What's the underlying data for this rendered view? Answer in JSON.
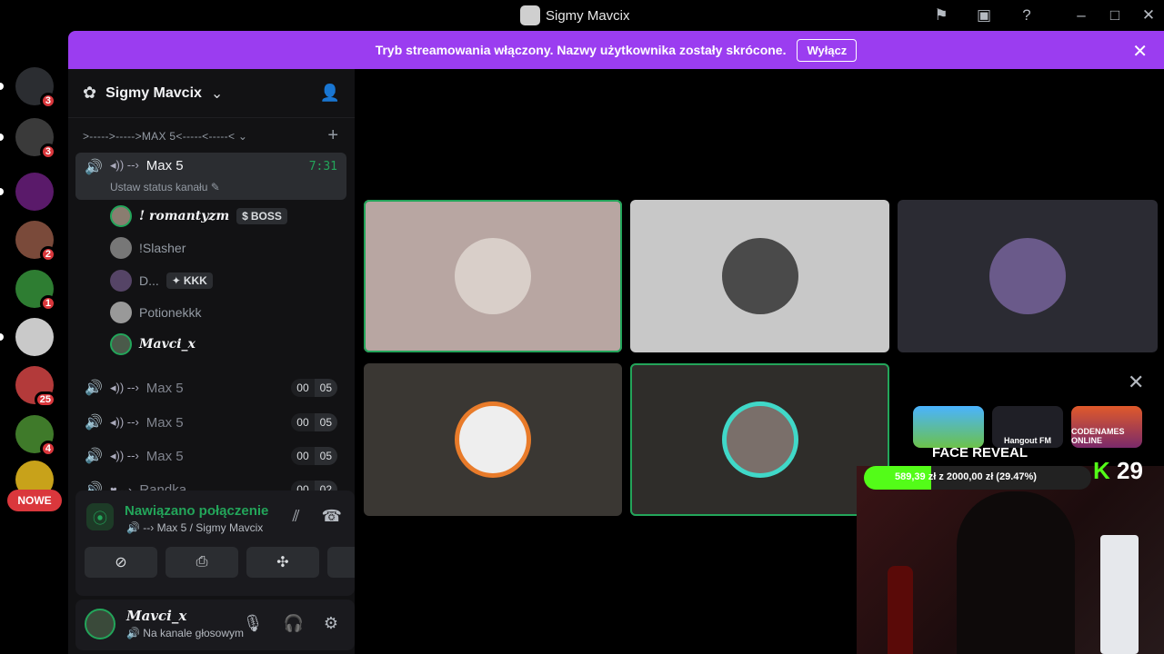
{
  "window": {
    "title": "Sigmy Mavcix"
  },
  "rail": {
    "servers": [
      {
        "name": "discord-home",
        "badge": "3",
        "color": "#2b2d31"
      },
      {
        "name": "server-2",
        "badge": "3",
        "color": "#3a3a3a"
      },
      {
        "name": "zakon",
        "badge": "",
        "color": "#5a1a6a"
      },
      {
        "name": "server-4",
        "badge": "2",
        "color": "#7a4a3a"
      },
      {
        "name": "server-5",
        "badge": "1",
        "color": "#2e7d32"
      },
      {
        "name": "server-6",
        "badge": "",
        "color": "#c9c9c9"
      },
      {
        "name": "server-7",
        "badge": "25",
        "color": "#b33a3a"
      },
      {
        "name": "server-8",
        "badge": "4",
        "color": "#3f7a2a"
      },
      {
        "name": "server-9",
        "badge": "",
        "color": "#c8a21a"
      }
    ],
    "new_label": "NOWE"
  },
  "banner": {
    "text": "Tryb streamowania włączony. Nazwy użytkownika zostały skrócone.",
    "button": "Wyłącz"
  },
  "server": {
    "name": "Sigmy Mavcix"
  },
  "category": {
    "name": ">----->----->MAX 5<-----<-----<"
  },
  "channels": [
    {
      "name": "Max 5",
      "time": "7:31",
      "status": "Ustaw status kanału",
      "active": true
    },
    {
      "name": "Max 5",
      "count_a": "00",
      "count_b": "05"
    },
    {
      "name": "Max 5",
      "count_a": "00",
      "count_b": "05"
    },
    {
      "name": "Max 5",
      "count_a": "00",
      "count_b": "05"
    },
    {
      "name": "Randka",
      "count_a": "00",
      "count_b": "02"
    }
  ],
  "members": [
    {
      "name": "! romantyzm",
      "tag": "BOSS"
    },
    {
      "name": "!Slasher",
      "tag": ""
    },
    {
      "name": "D...",
      "tag": "KKK"
    },
    {
      "name": "Potionekkk",
      "tag": ""
    },
    {
      "name": "Mavci_x",
      "tag": ""
    }
  ],
  "voice_panel": {
    "status": "Nawiązano połączenie",
    "location": "Max 5 / Sigmy Mavcix"
  },
  "user": {
    "name": "Mavci_x",
    "status": "Na kanale głosowym"
  },
  "activities": {
    "items": [
      "",
      "Hangout FM",
      "CODENAMES ONLINE"
    ],
    "label": "FACE REVEAL"
  },
  "stream": {
    "goal_text": "589,39 zł z 2000,00 zł (29.47%)",
    "goal_progress": 0.2947,
    "viewer_count": "29"
  },
  "colors": {
    "accent": "#9b3df0",
    "speaking": "#23a55a",
    "danger": "#da373c"
  }
}
